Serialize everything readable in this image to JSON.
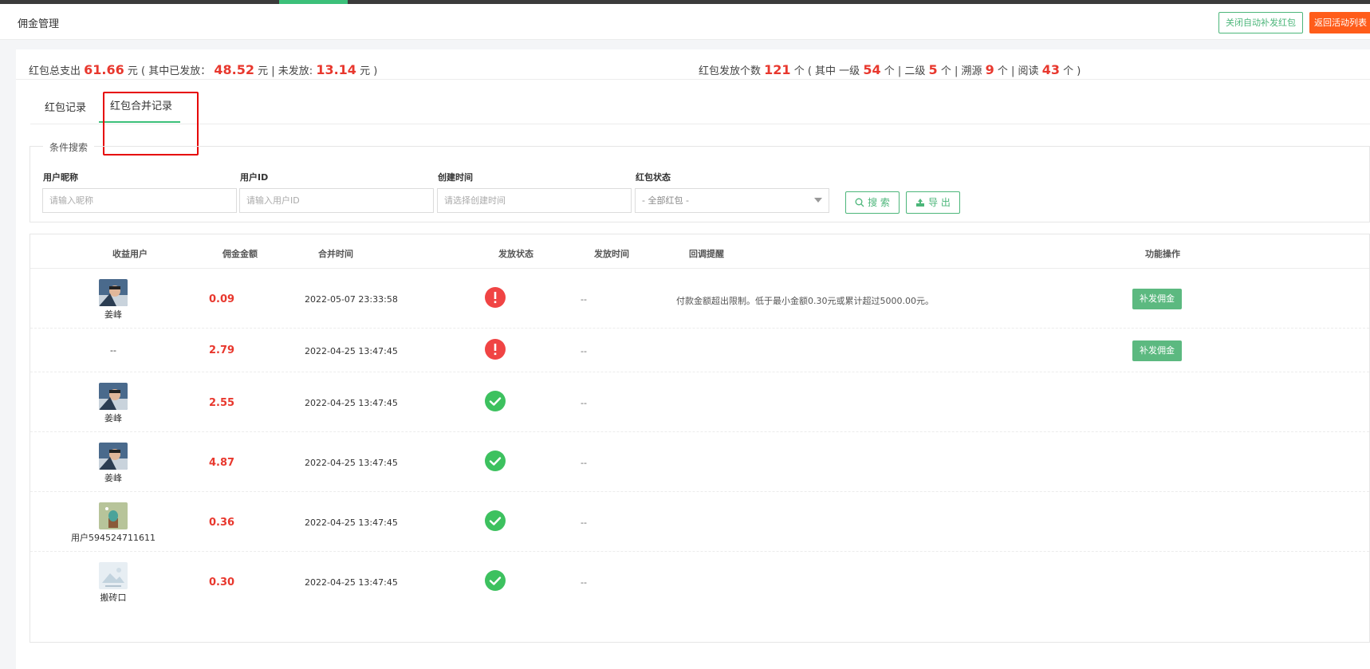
{
  "header": {
    "title": "佣金管理",
    "close_auto_button": "关闭自动补发红包",
    "back_button": "返回活动列表"
  },
  "stats": {
    "total_label": "红包总支出",
    "total_value": "61.66",
    "total_unit_open": "元 ( 其中已发放：",
    "sent_value": "48.52",
    "sent_unit": "元 | 未发放:",
    "unsent_value": "13.14",
    "unsent_unit": "元 )",
    "count_label": "红包发放个数",
    "count_value": "121",
    "count_unit_open": "个 ( 其中 一级",
    "level1_value": "54",
    "level1_unit": "个 | 二级",
    "level2_value": "5",
    "level2_unit": "个 | 溯源",
    "trace_value": "9",
    "trace_unit": "个 | 阅读",
    "read_value": "43",
    "read_unit": "个 )"
  },
  "tabs": [
    {
      "label": "红包记录"
    },
    {
      "label": "红包合并记录"
    }
  ],
  "search": {
    "legend": "条件搜索",
    "nickname_label": "用户昵称",
    "nickname_placeholder": "请输入昵称",
    "userid_label": "用户ID",
    "userid_placeholder": "请输入用户ID",
    "created_label": "创建时间",
    "created_placeholder": "请选择创建时间",
    "status_label": "红包状态",
    "status_selected": "- 全部红包 -",
    "search_button": "搜 索",
    "export_button": "导 出"
  },
  "table": {
    "headers": [
      "收益用户",
      "佣金金额",
      "合并时间",
      "发放状态",
      "发放时间",
      "回调提醒",
      "功能操作"
    ],
    "rows": [
      {
        "user": "姜峰",
        "avatar": "photo",
        "amount": "0.09",
        "merge_time": "2022-05-07 23:33:58",
        "status": "fail",
        "send_time": "--",
        "note": "付款金额超出限制。低于最小金额0.30元或累计超过5000.00元。",
        "action": "补发佣金"
      },
      {
        "user": "--",
        "avatar": "none",
        "amount": "2.79",
        "merge_time": "2022-04-25 13:47:45",
        "status": "fail",
        "send_time": "--",
        "note": "",
        "action": "补发佣金"
      },
      {
        "user": "姜峰",
        "avatar": "photo",
        "amount": "2.55",
        "merge_time": "2022-04-25 13:47:45",
        "status": "ok",
        "send_time": "--",
        "note": "",
        "action": ""
      },
      {
        "user": "姜峰",
        "avatar": "photo",
        "amount": "4.87",
        "merge_time": "2022-04-25 13:47:45",
        "status": "ok",
        "send_time": "--",
        "note": "",
        "action": ""
      },
      {
        "user": "用户594524711611",
        "avatar": "cactus",
        "amount": "0.36",
        "merge_time": "2022-04-25 13:47:45",
        "status": "ok",
        "send_time": "--",
        "note": "",
        "action": ""
      },
      {
        "user": "搬砖口",
        "avatar": "placeholder",
        "amount": "0.30",
        "merge_time": "2022-04-25 13:47:45",
        "status": "ok",
        "send_time": "--",
        "note": "",
        "action": ""
      }
    ]
  },
  "colors": {
    "accent_green": "#3cc07a",
    "danger_red": "#e8382e",
    "orange": "#ff5c1a"
  }
}
